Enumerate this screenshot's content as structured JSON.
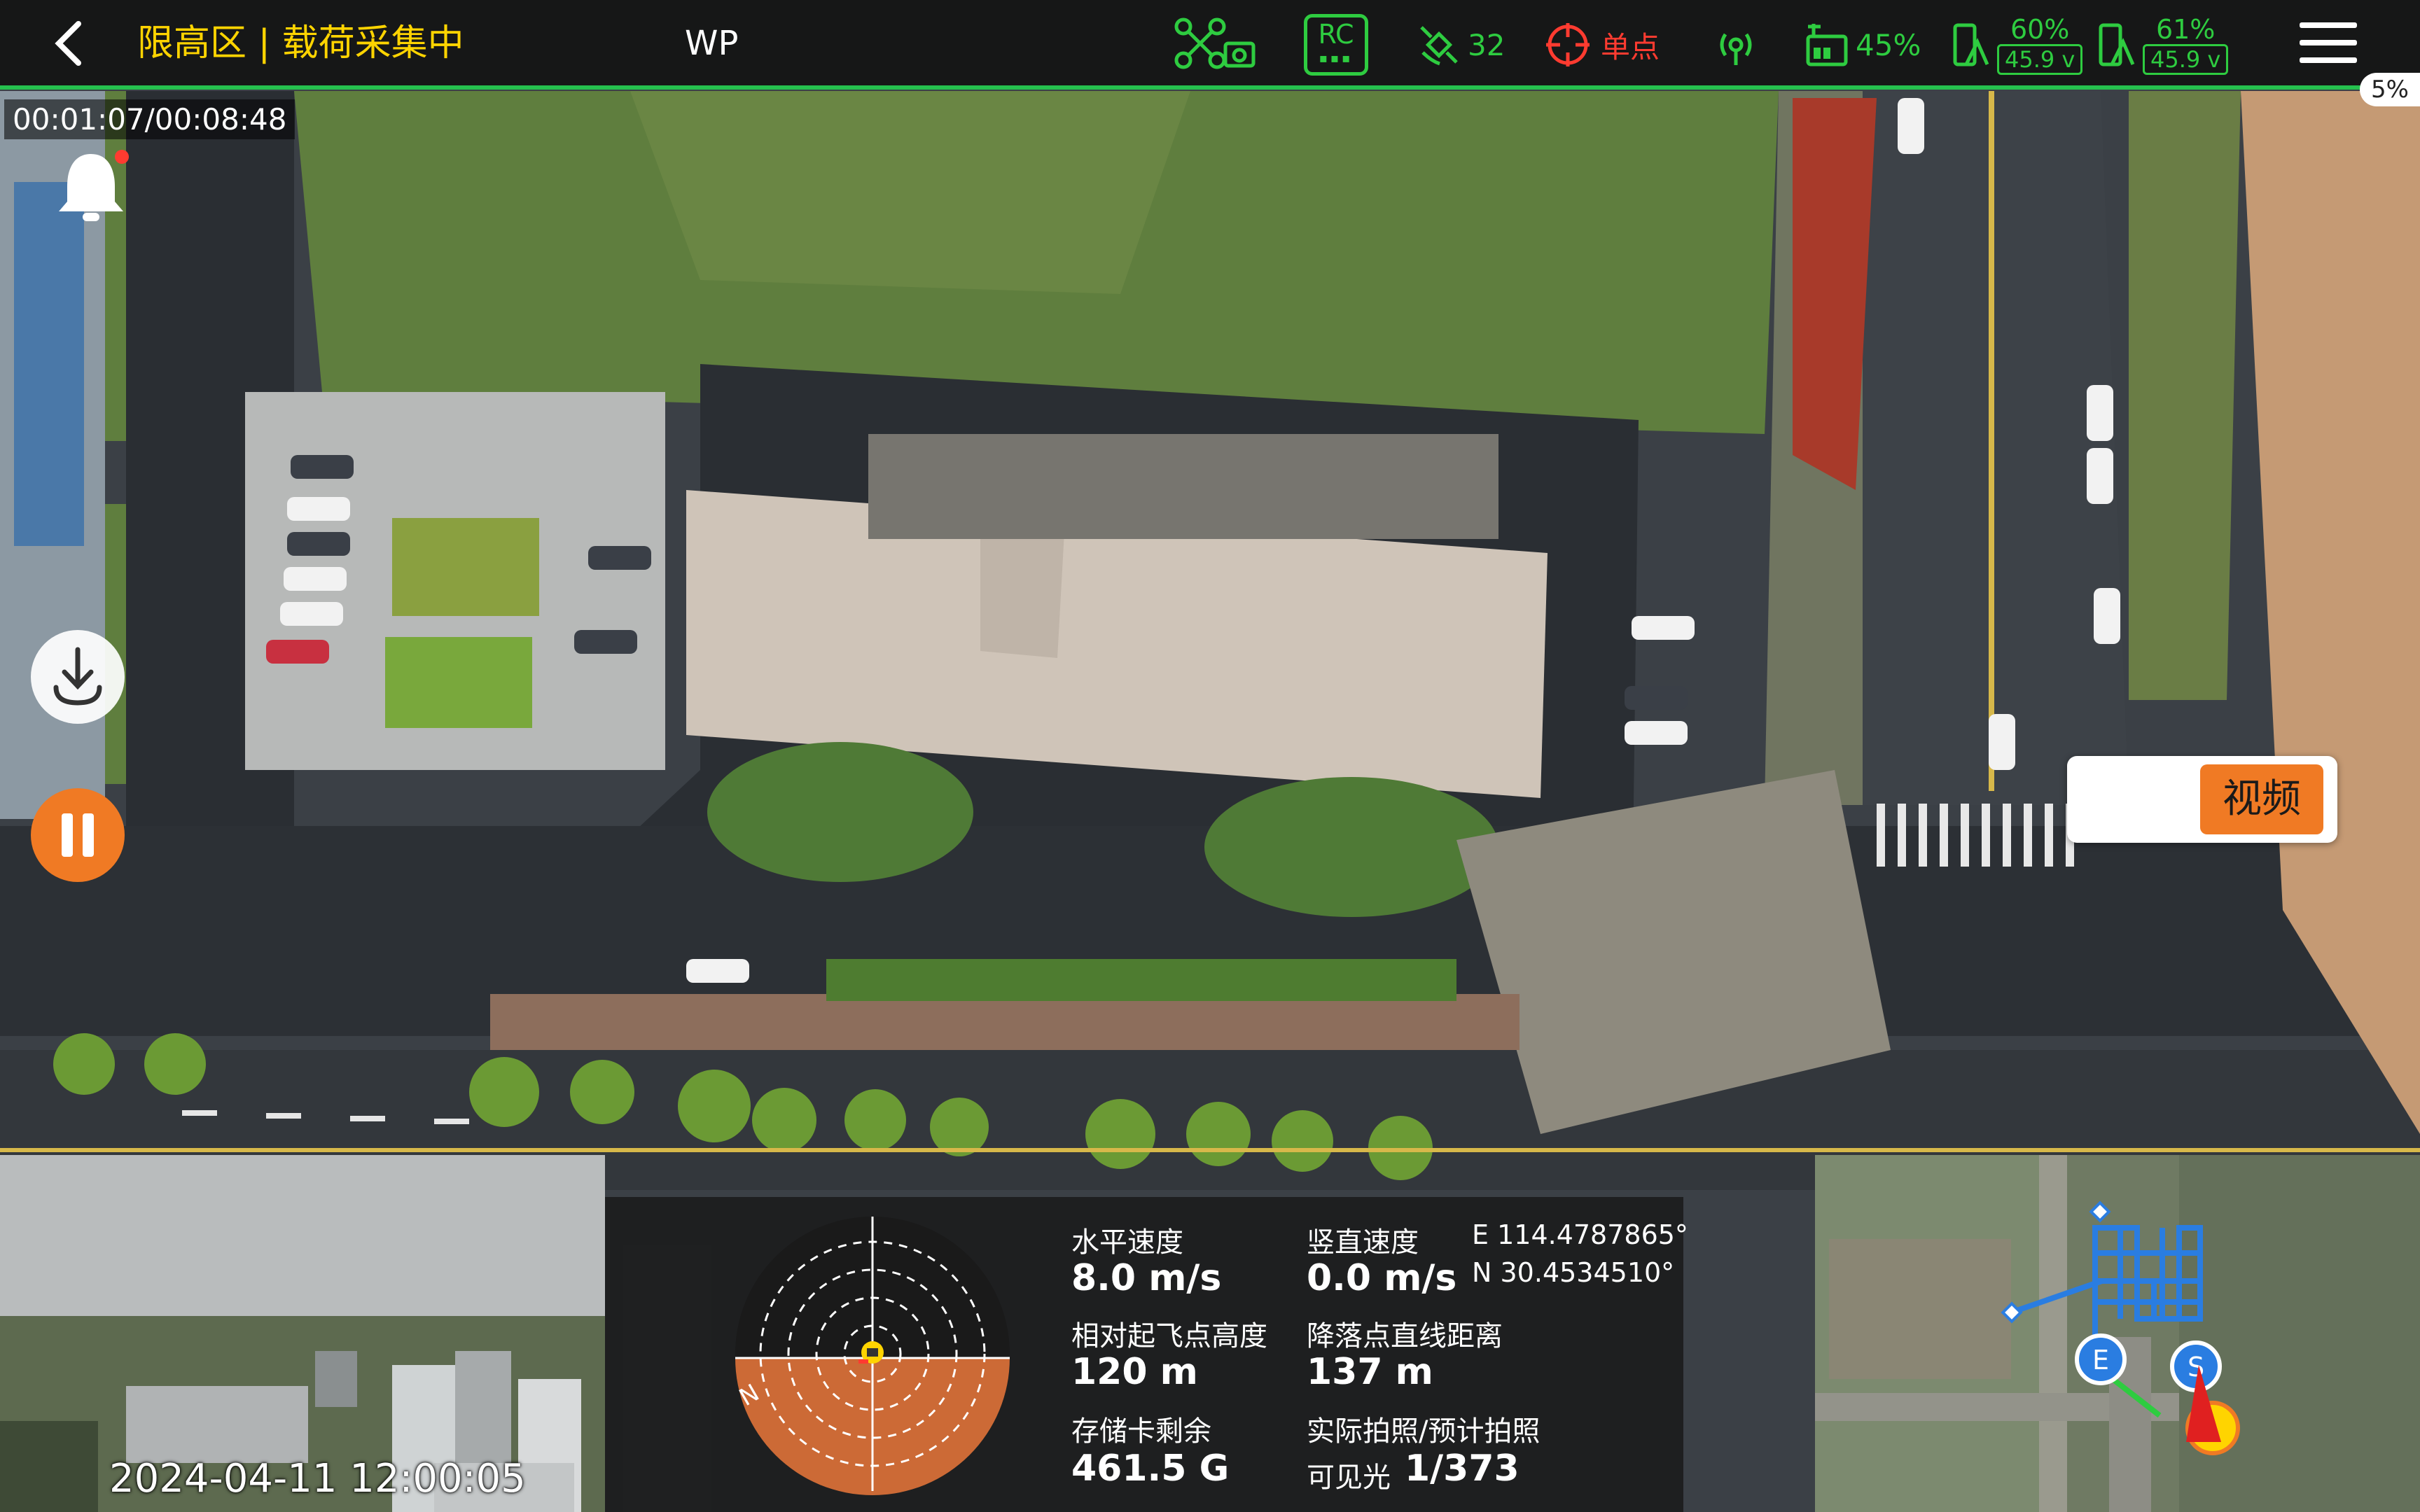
{
  "header": {
    "zone_title": "限高区 | 载荷采集中",
    "wp_label": "WP",
    "rc_label": "RC",
    "satellites": "32",
    "positioning": "单点",
    "drone_battery": "45%",
    "battery_left_pct": "60%",
    "battery_left_volt": "45.9 v",
    "battery_right_pct": "61%",
    "battery_right_volt": "45.9 v",
    "progress_pct": "5%"
  },
  "flight_timer": "00:01:07/00:08:48",
  "video_toggle_label": "视频",
  "camera_pip": {
    "timestamp": "2024-04-11 12:00:05"
  },
  "telemetry": {
    "horizontal_speed_label": "水平速度",
    "horizontal_speed_value": "8.0 m/s",
    "vertical_speed_label": "竖直速度",
    "vertical_speed_value": "0.0 m/s",
    "longitude": "E 114.4787865°",
    "latitude": "N 30.4534510°",
    "relative_altitude_label": "相对起飞点高度",
    "relative_altitude_value": "120 m",
    "landing_distance_label": "降落点直线距离",
    "landing_distance_value": "137 m",
    "storage_label": "存储卡剩余",
    "storage_value": "461.5 G",
    "photo_count_label": "实际拍照/预计拍照",
    "photo_mode": "可见光",
    "photo_count": "1/373",
    "compass_north": "N"
  },
  "minimap": {
    "start_marker": "E",
    "end_marker": "S"
  },
  "colors": {
    "accent_orange": "#f07a24",
    "status_green": "#2ecc40",
    "zone_yellow": "#ffd400",
    "alert_red": "#ff3b30"
  }
}
